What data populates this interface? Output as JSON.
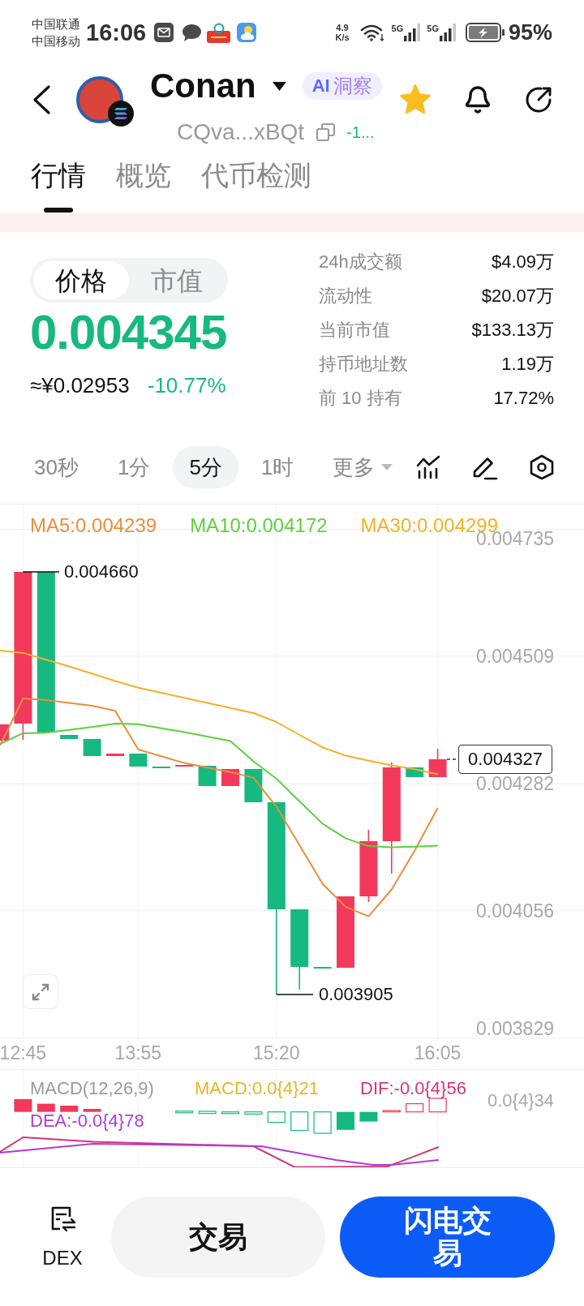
{
  "status_bar": {
    "carriers": [
      "中国联通",
      "中国移动"
    ],
    "time": "16:06",
    "speed": [
      "4.9",
      "K/s"
    ],
    "networks": [
      "5G",
      "5G"
    ],
    "battery": "95%"
  },
  "header": {
    "title": "Conan",
    "badge": {
      "logo": "AI",
      "label": "洞察"
    },
    "favorited": true,
    "address": "CQva...xBQt",
    "change": "-1..."
  },
  "tabs": [
    {
      "label": "行情",
      "selected": true
    },
    {
      "label": "概览",
      "selected": false
    },
    {
      "label": "代币检测",
      "selected": false
    }
  ],
  "price_toggle": [
    {
      "label": "价格",
      "selected": true
    },
    {
      "label": "市值",
      "selected": false
    }
  ],
  "price": {
    "value": "0.004345",
    "fiat": "≈¥0.02953",
    "change": "-10.77%"
  },
  "stats": [
    {
      "label": "24h成交额",
      "value": "$4.09万"
    },
    {
      "label": "流动性",
      "value": "$20.07万"
    },
    {
      "label": "当前市值",
      "value": "$133.13万"
    },
    {
      "label": "持币地址数",
      "value": "1.19万"
    },
    {
      "label": "前 10 持有",
      "value": "17.72%"
    }
  ],
  "intervals": [
    {
      "label": "30秒",
      "kind": "option",
      "selected": false
    },
    {
      "label": "1分",
      "kind": "option",
      "selected": false
    },
    {
      "label": "5分",
      "kind": "option",
      "selected": true
    },
    {
      "label": "1时",
      "kind": "option",
      "selected": false
    },
    {
      "label": "更多",
      "kind": "menu",
      "selected": false
    }
  ],
  "chart": {
    "chart_data": {
      "type": "line",
      "grid": true,
      "categories": [
        null,
        "12:45",
        null,
        null,
        null,
        null,
        "13:55",
        null,
        null,
        null,
        null,
        null,
        "15:20",
        null,
        null,
        null,
        null,
        null,
        null,
        "16:05"
      ],
      "ylim": [
        0.003829,
        0.004779
      ],
      "yticks": [
        0.004735,
        0.004509,
        0.004282,
        0.004056,
        0.003829
      ],
      "series": [
        {
          "name": "MA5:0.004239",
          "color": "#e88f3c",
          "values": [
            0.00435,
            0.004434,
            0.004431,
            0.004426,
            0.004421,
            0.004412,
            0.004343,
            0.004331,
            0.004319,
            0.004311,
            0.004303,
            0.004293,
            0.004241,
            0.004173,
            0.004104,
            0.004063,
            0.004046,
            0.004094,
            0.004163,
            0.004239
          ]
        },
        {
          "name": "MA10:0.004172",
          "color": "#5fcf3e",
          "values": [
            0.004353,
            0.004372,
            0.004373,
            0.004378,
            0.004383,
            0.004389,
            0.004388,
            0.004381,
            0.004374,
            0.004366,
            0.004358,
            0.004322,
            0.004291,
            0.004251,
            0.004211,
            0.004185,
            0.004171,
            0.004169,
            0.00417,
            0.004172
          ]
        },
        {
          "name": "MA30:0.004299",
          "color": "#f0b326",
          "values": [
            0.004519,
            0.004515,
            0.004503,
            0.004491,
            0.004478,
            0.004465,
            0.004453,
            0.004444,
            0.004435,
            0.004426,
            0.004417,
            0.004408,
            0.004392,
            0.004369,
            0.004347,
            0.004332,
            0.004323,
            0.004315,
            0.004308,
            0.004299
          ]
        }
      ]
    },
    "high": "0.004660",
    "low": "0.003905",
    "last_price": "0.004327"
  },
  "macd": {
    "legend": [
      {
        "label": "MACD(12,26,9)",
        "color": "#9a9a9a"
      },
      {
        "label": "MACD:0.0{4}21",
        "color": "#e9b526"
      },
      {
        "label": "DIF:-0.0{4}56",
        "color": "#d6357a"
      },
      {
        "label": "DEA:-0.0{4}78",
        "color": "#b03cd4"
      }
    ],
    "scale_label": "0.0{4}34"
  },
  "actions": {
    "dex": "DEX",
    "buttons": [
      {
        "label": "交易",
        "kind": "secondary"
      },
      {
        "label": "闪电交易",
        "kind": "primary"
      }
    ]
  }
}
